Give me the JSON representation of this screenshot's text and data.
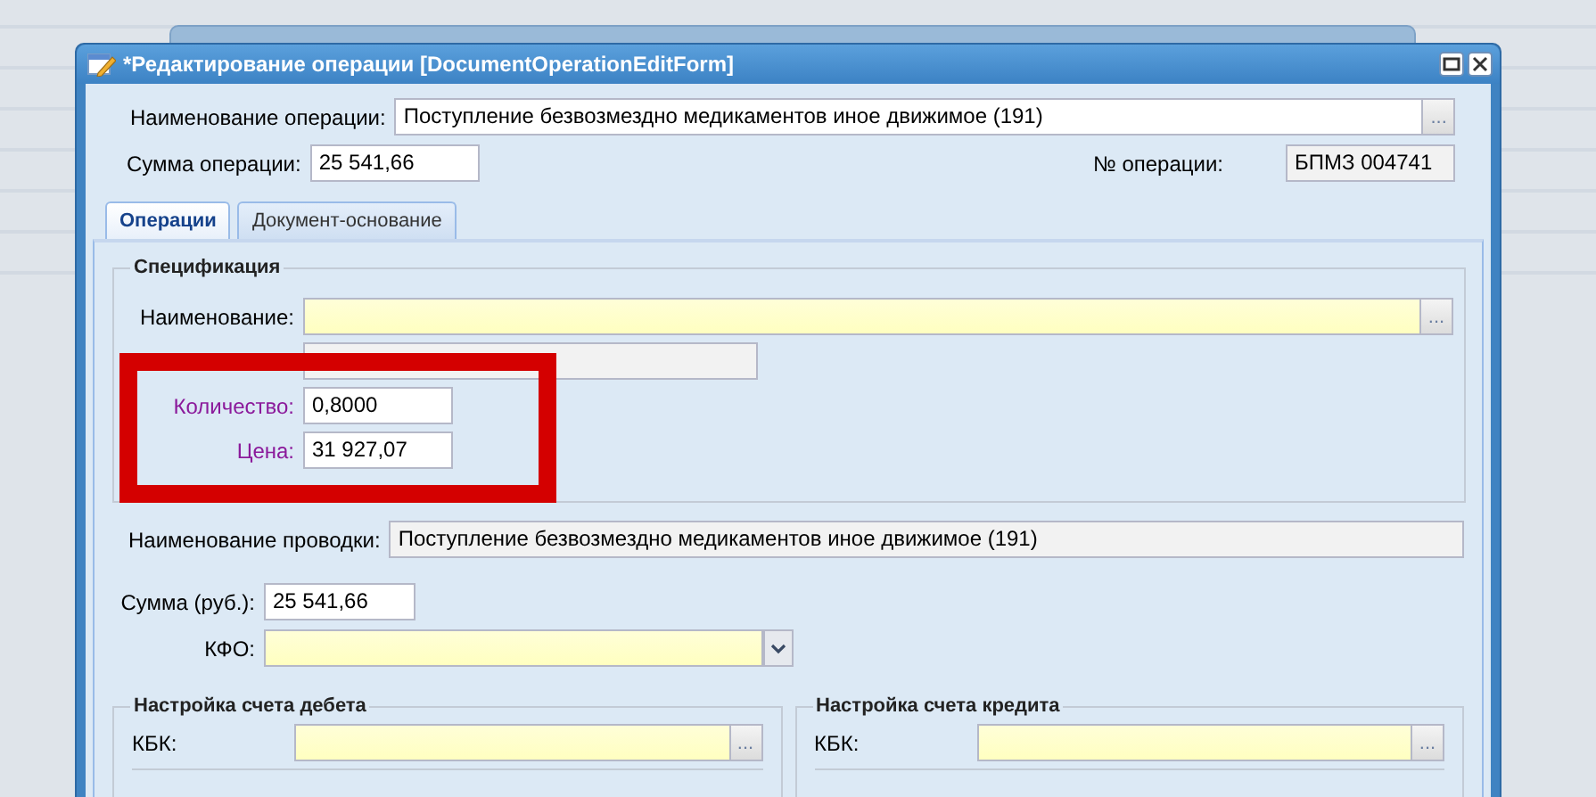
{
  "window": {
    "title": "*Редактирование операции [DocumentOperationEditForm]"
  },
  "operation_name": {
    "label": "Наименование операции:",
    "value": "Поступление безвозмездно медикаментов иное движимое (191)",
    "trigger": "..."
  },
  "operation_sum": {
    "label": "Сумма операции:",
    "value": "25 541,66"
  },
  "operation_number": {
    "label": "№ операции:",
    "value": "БПМЗ 004741",
    "readonly": true
  },
  "tabs": [
    {
      "label": "Операции",
      "selected": true
    },
    {
      "label": "Документ-основание",
      "selected": false
    }
  ],
  "specification": {
    "title": "Спецификация",
    "fields": [
      {
        "kind": "lookup",
        "label": "Наименование:",
        "trigger": "...",
        "required": true,
        "readonly": false,
        "highlighted": false
      },
      {
        "kind": "text",
        "required": false,
        "readonly": true
      },
      {
        "kind": "text",
        "label": "Количество:",
        "value": "0,8000",
        "required": false,
        "readonly": false,
        "highlighted": true
      },
      {
        "kind": "text",
        "label": "Цена:",
        "value": "31 927,07",
        "required": false,
        "readonly": false,
        "highlighted": true
      }
    ]
  },
  "annotation": {
    "kind": "frame",
    "color": "#d40000"
  },
  "posting_name": {
    "label": "Наименование проводки:",
    "value": "Поступление безвозмездно медикаментов иное движимое (191)",
    "readonly": true
  },
  "posting_sum": {
    "label": "Сумма (руб.):",
    "value": "25 541,66"
  },
  "kfo": {
    "kind": "combo",
    "label": "КФО:",
    "required": true
  },
  "accounts": [
    {
      "title": "Настройка счета дебета",
      "kbk": {
        "label": "КБК:",
        "trigger": "...",
        "required": true
      }
    },
    {
      "title": "Настройка счета кредита",
      "kbk": {
        "label": "КБК:",
        "trigger": "...",
        "required": true
      }
    }
  ]
}
